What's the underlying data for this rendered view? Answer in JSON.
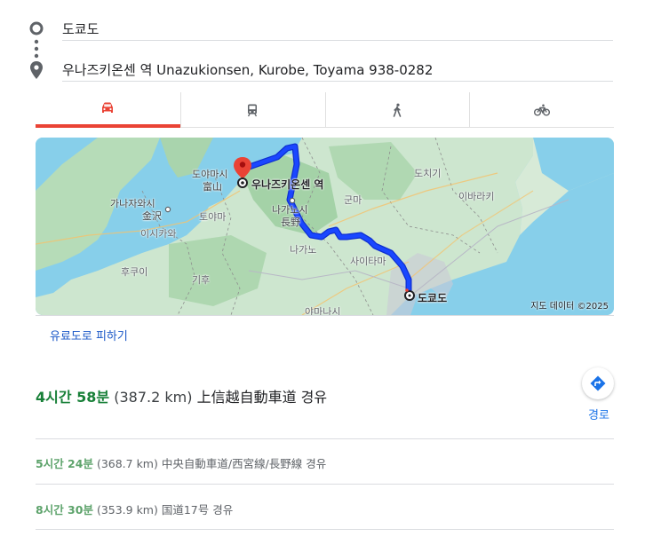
{
  "directions": {
    "origin": "도쿄도",
    "destination": "우나즈키온센 역 Unazukionsen, Kurobe, Toyama 938-0282"
  },
  "modes": [
    {
      "icon": "car-icon",
      "active": true
    },
    {
      "icon": "train-icon",
      "active": false
    },
    {
      "icon": "walk-icon",
      "active": false
    },
    {
      "icon": "bike-icon",
      "active": false
    }
  ],
  "map": {
    "credit": "지도 데이터 ©2025",
    "labels": {
      "toyama": "도야마시",
      "toyama_kanji": "富山",
      "unazuki": "우나즈키온센 역",
      "kanazawa": "가나자와시",
      "kanazawa_kanji": "金沢",
      "toyama_pref": "토야마",
      "nagano": "나가노시",
      "nagano_kanji": "長野",
      "ishikawa": "이시카와",
      "gunma": "군마",
      "tochigi": "도치기",
      "ibaraki": "이바라키",
      "nagano_pref": "나가노",
      "fukui": "후쿠이",
      "gifu": "기후",
      "saitama": "사이타마",
      "tokyo": "도쿄도",
      "yamanashi": "야마나시"
    },
    "colors": {
      "route": "#1a47ff",
      "route_border": "#0e2fd0",
      "water": "#87cfea",
      "land": "#cfe6cf"
    }
  },
  "avoid_tolls": "유료도로 피하기",
  "primary_route": {
    "time": "4시간 58분",
    "distance": "(387.2 km)",
    "via": "上信越自動車道 경유"
  },
  "route_button_label": "경로",
  "alternatives": [
    {
      "time": "5시간 24분",
      "distance": "(368.7 km)",
      "via": "中央自動車道/西宮線/長野線 경유"
    },
    {
      "time": "8시간 30분",
      "distance": "(353.9 km)",
      "via": "国道17号 경유"
    }
  ]
}
